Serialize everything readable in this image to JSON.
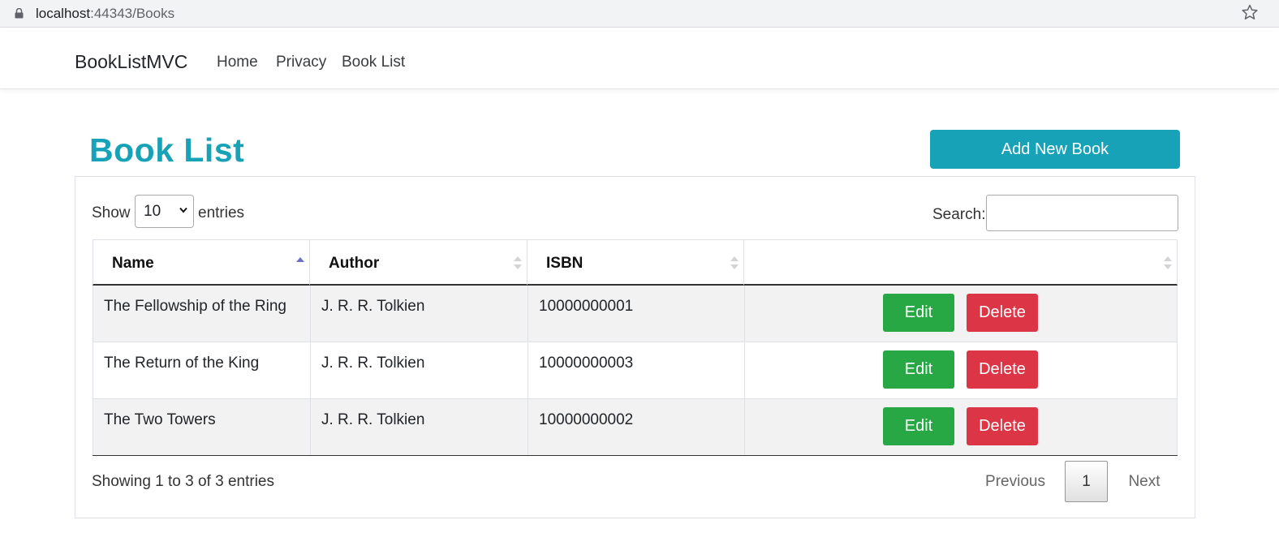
{
  "browser": {
    "url_host": "localhost",
    "url_path": ":44343/Books"
  },
  "navbar": {
    "brand": "BookListMVC",
    "links": [
      "Home",
      "Privacy",
      "Book List"
    ]
  },
  "page": {
    "title": "Book List",
    "add_button": "Add New Book"
  },
  "table_controls": {
    "show_label": "Show",
    "page_length": "10",
    "entries_label": "entries",
    "search_label": "Search:",
    "search_value": ""
  },
  "table": {
    "columns": [
      "Name",
      "Author",
      "ISBN",
      ""
    ],
    "sorted_column": "Name",
    "sort_direction": "ascending",
    "rows": [
      {
        "name": "The Fellowship of the Ring",
        "author": "J. R. R. Tolkien",
        "isbn": "10000000001",
        "edit": "Edit",
        "delete": "Delete"
      },
      {
        "name": "The Return of the King",
        "author": "J. R. R. Tolkien",
        "isbn": "10000000003",
        "edit": "Edit",
        "delete": "Delete"
      },
      {
        "name": "The Two Towers",
        "author": "J. R. R. Tolkien",
        "isbn": "10000000002",
        "edit": "Edit",
        "delete": "Delete"
      }
    ]
  },
  "footer": {
    "info": "Showing 1 to 3 of 3 entries",
    "previous": "Previous",
    "current_page": "1",
    "next": "Next"
  },
  "colors": {
    "primary": "#17a2b8",
    "success": "#28a745",
    "danger": "#dc3545"
  },
  "icons": [
    "lock-icon",
    "star-icon",
    "chevron-down-icon",
    "sort-asc-icon",
    "sort-both-icon"
  ]
}
